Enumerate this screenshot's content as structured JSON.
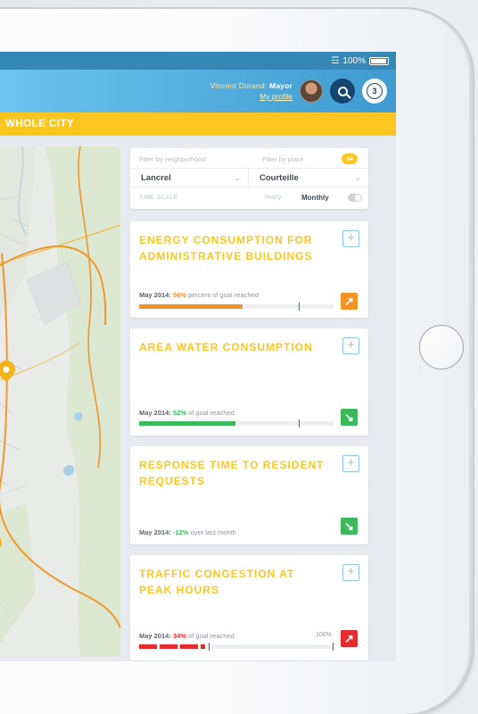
{
  "status": {
    "battery_text": "100%"
  },
  "header": {
    "user_role": "Vincent Durand",
    "user_title": "Mayor",
    "profile_link": "My profile",
    "notification_count": "3"
  },
  "scope": {
    "title": "WHOLE CITY"
  },
  "filters": {
    "neighborhood_label": "Filter by neighborhood",
    "place_label": "Filter by place",
    "place_count": "34",
    "neighborhood_value": "Lancrel",
    "place_value": "Courteille",
    "time_scale_label": "TIME SCALE",
    "yearly_label": "Yearly",
    "monthly_label": "Monthly"
  },
  "kpis": [
    {
      "title": "ENERGY CONSUMPTION FOR ADMINISTRATIVE BUILDINGS",
      "period": "May 2014:",
      "value": "56%",
      "suffix": "percent of goal reached",
      "progress": 0.56,
      "target": 0.82,
      "trend": "up",
      "trend_color": "#f39323",
      "bar_color": "#f39323"
    },
    {
      "title": "AREA WATER CONSUMPTION",
      "period": "May 2014:",
      "value": "52%",
      "suffix": "of goal reached",
      "progress": 0.52,
      "target": 0.82,
      "trend": "down",
      "trend_color": "#3cba5b",
      "bar_color": "#3cba5b"
    },
    {
      "title": "RESPONSE TIME TO RESIDENT REQUESTS",
      "period": "May 2014:",
      "value": "-12%",
      "suffix": "over last month",
      "trend": "down",
      "trend_color": "#3cba5b"
    },
    {
      "title": "TRAFFIC CONGESTION AT PEAK HOURS",
      "period": "May 2014:",
      "value": "34%",
      "suffix": "of goal reached",
      "hundred_label": "100%",
      "progress": 0.34,
      "trend": "up",
      "trend_color": "#e52b2b",
      "bar_color": "#e52b2b"
    }
  ],
  "colors": {
    "accent_yellow": "#fcc51f",
    "header_blue": "#3e9ad0",
    "navy": "#14466e"
  }
}
